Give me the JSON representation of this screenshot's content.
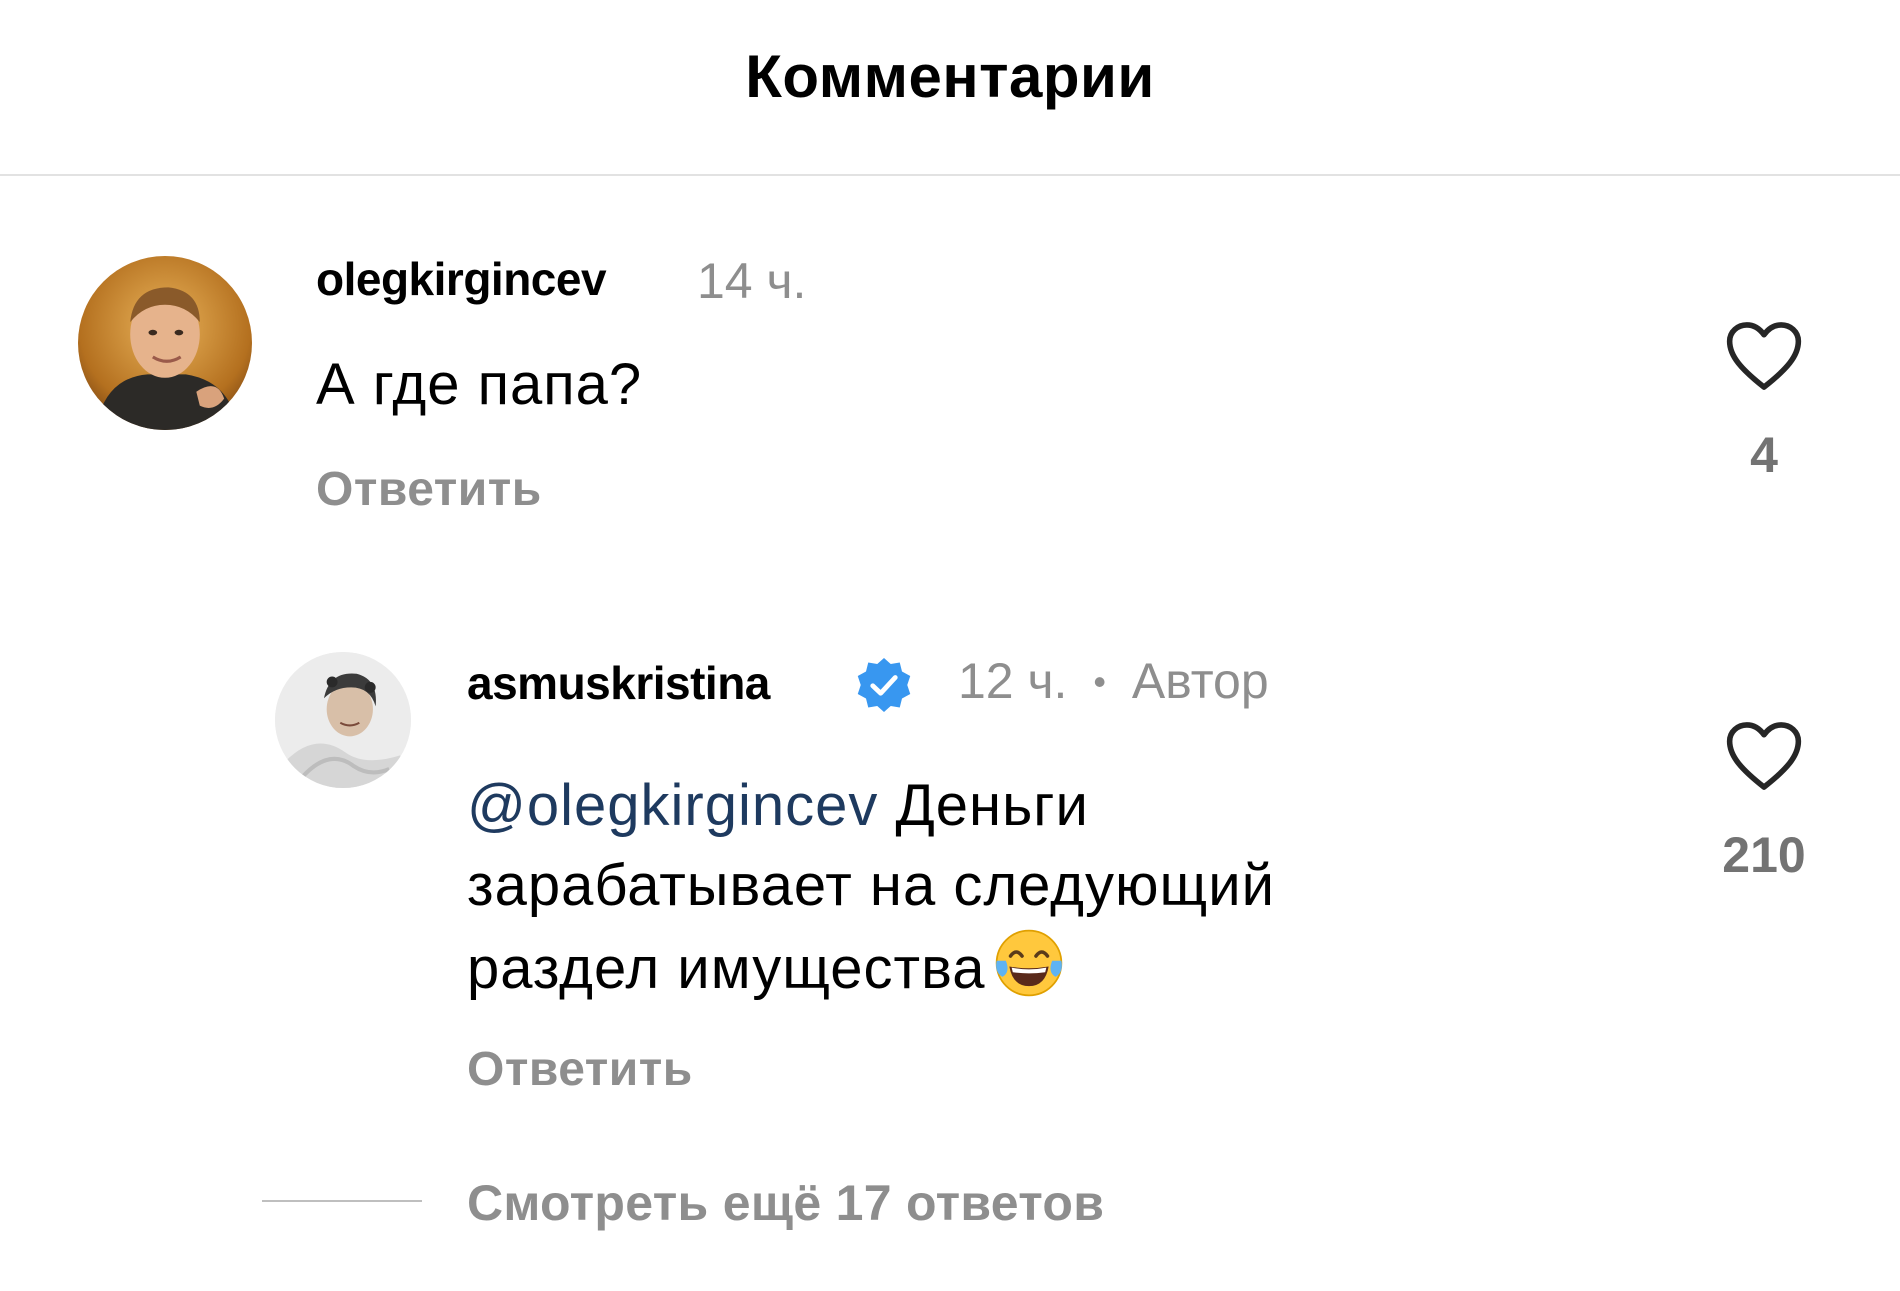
{
  "header": {
    "title": "Комментарии"
  },
  "comments": [
    {
      "username": "olegkirgincev",
      "time": "14 ч.",
      "text": "А где папа?",
      "reply_label": "Ответить",
      "likes": "4",
      "avatar_icon": "avatar-olegkirgincev"
    }
  ],
  "replies": [
    {
      "username": "asmuskristina",
      "verified": true,
      "time": "12 ч.",
      "separator": "•",
      "author_label": "Автор",
      "mention": "@olegkirgincev",
      "text_line1": " Деньги",
      "text_line2": "зарабатывает на следующий",
      "text_line3": "раздел имущества",
      "emoji_icon": "face-with-tears-of-joy",
      "reply_label": "Ответить",
      "likes": "210",
      "avatar_icon": "avatar-asmuskristina"
    }
  ],
  "view_more": {
    "label": "Смотреть ещё 17 ответов"
  },
  "colors": {
    "secondary_text": "#8e8e8e",
    "mention": "#1e3a5f",
    "verified_badge": "#3897f0",
    "divider": "#e2e2e2"
  }
}
